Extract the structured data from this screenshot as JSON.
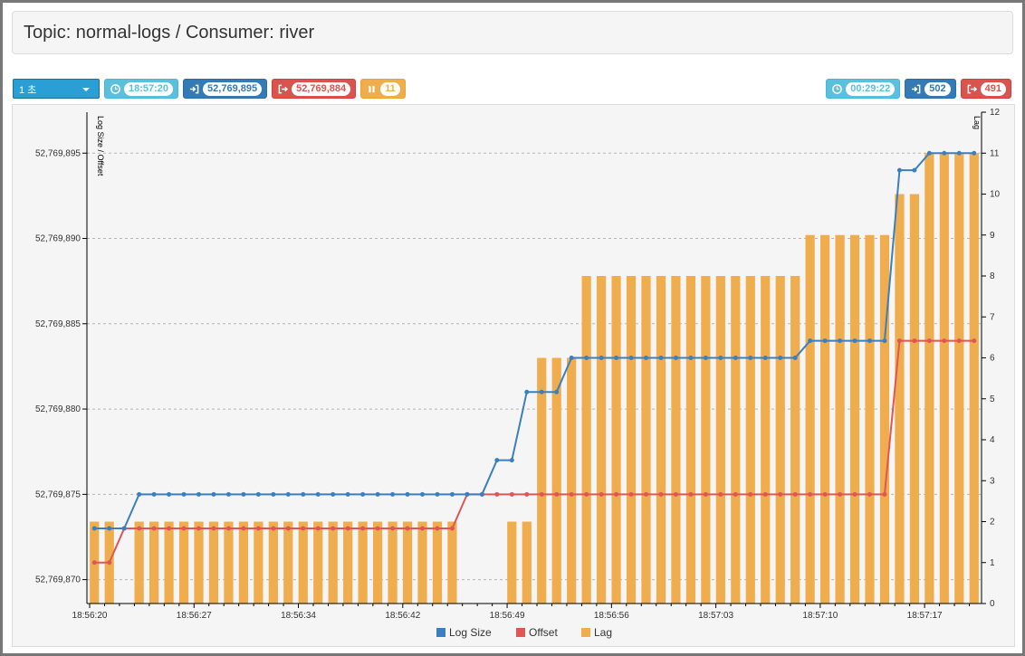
{
  "header": {
    "title": "Topic: normal-logs / Consumer: river"
  },
  "toolbar": {
    "interval": "1 초",
    "left_badges": [
      {
        "icon": "clock-icon",
        "value": "18:57:20"
      },
      {
        "icon": "sign-in-icon",
        "value": "52,769,895"
      },
      {
        "icon": "sign-out-icon",
        "value": "52,769,884"
      },
      {
        "icon": "pause-icon",
        "value": "11"
      }
    ],
    "right_badges": [
      {
        "icon": "clock-icon",
        "value": "00:29:22"
      },
      {
        "icon": "sign-in-icon",
        "value": "502"
      },
      {
        "icon": "sign-out-icon",
        "value": "491"
      }
    ]
  },
  "colors": {
    "log_size": "#3a7fc1",
    "offset": "#e05656",
    "lag": "#f0ad4e",
    "info": "#5bc0de",
    "primary": "#337ab7",
    "danger": "#d9534f",
    "warning": "#f0ad4e"
  },
  "chart_data": {
    "type": "line",
    "x_start": "18:56:20",
    "x_tick_labels": [
      "18:56:20",
      "18:56:27",
      "18:56:34",
      "18:56:42",
      "18:56:49",
      "18:56:56",
      "18:57:03",
      "18:57:10",
      "18:57:17"
    ],
    "series": [
      {
        "name": "Log Size",
        "type": "line",
        "axis": "left",
        "values": [
          52769873,
          52769873,
          52769873,
          52769875,
          52769875,
          52769875,
          52769875,
          52769875,
          52769875,
          52769875,
          52769875,
          52769875,
          52769875,
          52769875,
          52769875,
          52769875,
          52769875,
          52769875,
          52769875,
          52769875,
          52769875,
          52769875,
          52769875,
          52769875,
          52769875,
          52769875,
          52769875,
          52769877,
          52769877,
          52769881,
          52769881,
          52769881,
          52769883,
          52769883,
          52769883,
          52769883,
          52769883,
          52769883,
          52769883,
          52769883,
          52769883,
          52769883,
          52769883,
          52769883,
          52769883,
          52769883,
          52769883,
          52769883,
          52769884,
          52769884,
          52769884,
          52769884,
          52769884,
          52769884,
          52769894,
          52769894,
          52769895,
          52769895,
          52769895,
          52769895
        ]
      },
      {
        "name": "Offset",
        "type": "line",
        "axis": "left",
        "values": [
          52769871,
          52769871,
          52769873,
          52769873,
          52769873,
          52769873,
          52769873,
          52769873,
          52769873,
          52769873,
          52769873,
          52769873,
          52769873,
          52769873,
          52769873,
          52769873,
          52769873,
          52769873,
          52769873,
          52769873,
          52769873,
          52769873,
          52769873,
          52769873,
          52769873,
          52769875,
          52769875,
          52769875,
          52769875,
          52769875,
          52769875,
          52769875,
          52769875,
          52769875,
          52769875,
          52769875,
          52769875,
          52769875,
          52769875,
          52769875,
          52769875,
          52769875,
          52769875,
          52769875,
          52769875,
          52769875,
          52769875,
          52769875,
          52769875,
          52769875,
          52769875,
          52769875,
          52769875,
          52769875,
          52769884,
          52769884,
          52769884,
          52769884,
          52769884,
          52769884
        ]
      },
      {
        "name": "Lag",
        "type": "bar",
        "axis": "right",
        "values": [
          2,
          2,
          0,
          2,
          2,
          2,
          2,
          2,
          2,
          2,
          2,
          2,
          2,
          2,
          2,
          2,
          2,
          2,
          2,
          2,
          2,
          2,
          2,
          2,
          2,
          0,
          0,
          0,
          2,
          2,
          6,
          6,
          6,
          8,
          8,
          8,
          8,
          8,
          8,
          8,
          8,
          8,
          8,
          8,
          8,
          8,
          8,
          8,
          9,
          9,
          9,
          9,
          9,
          9,
          10,
          10,
          11,
          11,
          11,
          11
        ]
      }
    ],
    "y_left": {
      "label": "Log Size / Offset",
      "min": 52769868.6,
      "max": 52769897.4,
      "ticks": [
        52769870,
        52769875,
        52769880,
        52769885,
        52769890,
        52769895
      ],
      "tick_labels": [
        "52,769,870",
        "52,769,875",
        "52,769,880",
        "52,769,885",
        "52,769,890",
        "52,769,895"
      ]
    },
    "y_right": {
      "label": "Lag",
      "min": 0,
      "max": 12,
      "ticks": [
        0,
        1,
        2,
        3,
        4,
        5,
        6,
        7,
        8,
        9,
        10,
        11,
        12
      ],
      "tick_labels": [
        "0",
        "1",
        "2",
        "3",
        "4",
        "5",
        "6",
        "7",
        "8",
        "9",
        "10",
        "11",
        "12"
      ]
    },
    "grid": true,
    "legend": {
      "position": "bottom-center",
      "items": [
        "Log Size",
        "Offset",
        "Lag"
      ]
    }
  }
}
